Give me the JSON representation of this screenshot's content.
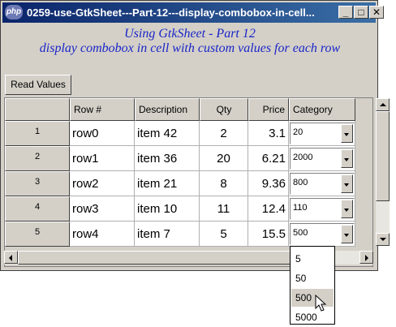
{
  "window": {
    "icon_text": "php",
    "title": "0259-use-GtkSheet---Part-12---display-combobox-in-cell...",
    "min_label": "_",
    "max_label": "□",
    "close_label": "✕"
  },
  "heading": {
    "line1": "Using GtkSheet - Part 12",
    "line2": "display combobox in cell with custom values for each row"
  },
  "toolbar": {
    "read_values_label": "Read Values"
  },
  "sheet": {
    "columns": [
      "Row #",
      "Description",
      "Qty",
      "Price",
      "Category"
    ],
    "rows": [
      {
        "num": "1",
        "row": "row0",
        "desc": "item 42",
        "qty": "2",
        "price": "3.1",
        "category": "20"
      },
      {
        "num": "2",
        "row": "row1",
        "desc": "item 36",
        "qty": "20",
        "price": "6.21",
        "category": "2000"
      },
      {
        "num": "3",
        "row": "row2",
        "desc": "item 21",
        "qty": "8",
        "price": "9.36",
        "category": "800"
      },
      {
        "num": "4",
        "row": "row3",
        "desc": "item 10",
        "qty": "11",
        "price": "12.4",
        "category": "110"
      },
      {
        "num": "5",
        "row": "row4",
        "desc": "item 7",
        "qty": "5",
        "price": "15.5",
        "category": "500"
      }
    ]
  },
  "dropdown": {
    "options": [
      "5",
      "50",
      "500",
      "5000"
    ],
    "selected_index": 2
  },
  "icons": {
    "app": "php-icon",
    "combo_arrow": "chevron-down-icon",
    "cursor": "mouse-pointer-icon"
  }
}
